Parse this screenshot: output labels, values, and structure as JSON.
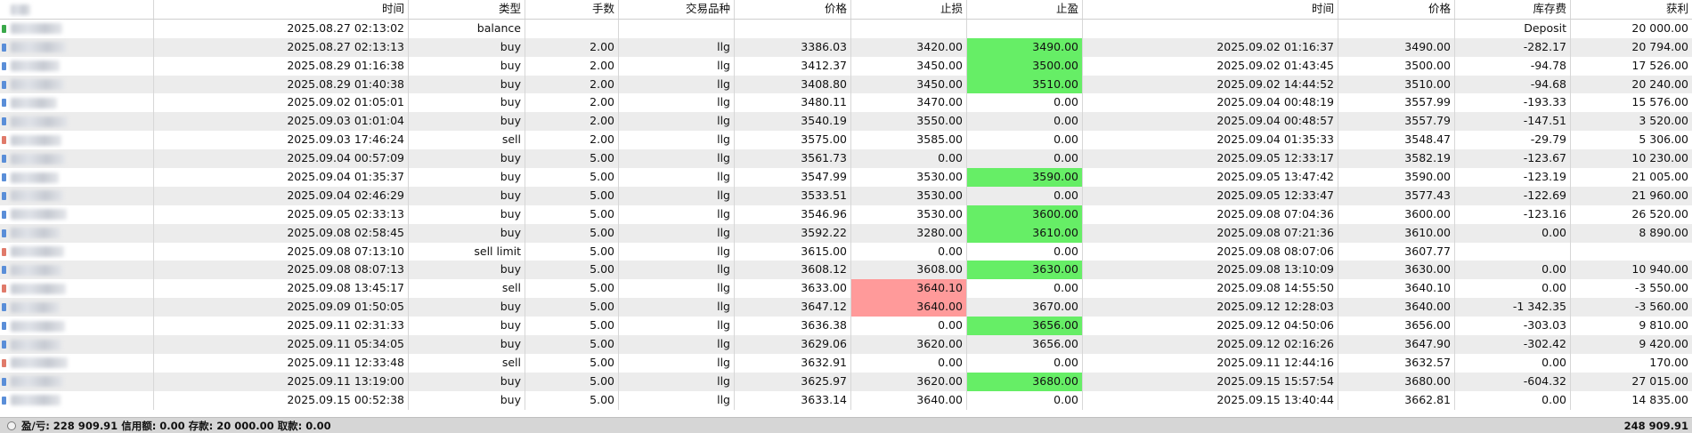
{
  "columns": {
    "id": "",
    "time": "时间",
    "type": "类型",
    "volume": "手数",
    "symbol": "交易品种",
    "price": "价格",
    "sl": "止损",
    "tp": "止盈",
    "close_time": "时间",
    "close_price": "价格",
    "swap": "库存费",
    "profit": "获利"
  },
  "rows": [
    {
      "time": "2025.08.27 02:13:02",
      "type": "balance",
      "volume": "",
      "symbol": "",
      "price": "",
      "sl": "",
      "tp": "",
      "close_time": "",
      "close_price": "",
      "swap": "Deposit",
      "profit": "20 000.00",
      "marker": "#3aa84a",
      "tp_hl": ""
    },
    {
      "time": "2025.08.27 02:13:13",
      "type": "buy",
      "volume": "2.00",
      "symbol": "llg",
      "price": "3386.03",
      "sl": "3420.00",
      "tp": "3490.00",
      "close_time": "2025.09.02 01:16:37",
      "close_price": "3490.00",
      "swap": "-282.17",
      "profit": "20 794.00",
      "marker": "#5a8ed8",
      "tp_hl": "green"
    },
    {
      "time": "2025.08.29 01:16:38",
      "type": "buy",
      "volume": "2.00",
      "symbol": "llg",
      "price": "3412.37",
      "sl": "3450.00",
      "tp": "3500.00",
      "close_time": "2025.09.02 01:43:45",
      "close_price": "3500.00",
      "swap": "-94.78",
      "profit": "17 526.00",
      "marker": "#5a8ed8",
      "tp_hl": "green"
    },
    {
      "time": "2025.08.29 01:40:38",
      "type": "buy",
      "volume": "2.00",
      "symbol": "llg",
      "price": "3408.80",
      "sl": "3450.00",
      "tp": "3510.00",
      "close_time": "2025.09.02 14:44:52",
      "close_price": "3510.00",
      "swap": "-94.68",
      "profit": "20 240.00",
      "marker": "#5a8ed8",
      "tp_hl": "green"
    },
    {
      "time": "2025.09.02 01:05:01",
      "type": "buy",
      "volume": "2.00",
      "symbol": "llg",
      "price": "3480.11",
      "sl": "3470.00",
      "tp": "0.00",
      "close_time": "2025.09.04 00:48:19",
      "close_price": "3557.99",
      "swap": "-193.33",
      "profit": "15 576.00",
      "marker": "#5a8ed8",
      "tp_hl": ""
    },
    {
      "time": "2025.09.03 01:01:04",
      "type": "buy",
      "volume": "2.00",
      "symbol": "llg",
      "price": "3540.19",
      "sl": "3550.00",
      "tp": "0.00",
      "close_time": "2025.09.04 00:48:57",
      "close_price": "3557.79",
      "swap": "-147.51",
      "profit": "3 520.00",
      "marker": "#5a8ed8",
      "tp_hl": ""
    },
    {
      "time": "2025.09.03 17:46:24",
      "type": "sell",
      "volume": "2.00",
      "symbol": "llg",
      "price": "3575.00",
      "sl": "3585.00",
      "tp": "0.00",
      "close_time": "2025.09.04 01:35:33",
      "close_price": "3548.47",
      "swap": "-29.79",
      "profit": "5 306.00",
      "marker": "#e07a6a",
      "tp_hl": ""
    },
    {
      "time": "2025.09.04 00:57:09",
      "type": "buy",
      "volume": "5.00",
      "symbol": "llg",
      "price": "3561.73",
      "sl": "0.00",
      "tp": "0.00",
      "close_time": "2025.09.05 12:33:17",
      "close_price": "3582.19",
      "swap": "-123.67",
      "profit": "10 230.00",
      "marker": "#5a8ed8",
      "tp_hl": ""
    },
    {
      "time": "2025.09.04 01:35:37",
      "type": "buy",
      "volume": "5.00",
      "symbol": "llg",
      "price": "3547.99",
      "sl": "3530.00",
      "tp": "3590.00",
      "close_time": "2025.09.05 13:47:42",
      "close_price": "3590.00",
      "swap": "-123.19",
      "profit": "21 005.00",
      "marker": "#5a8ed8",
      "tp_hl": "green"
    },
    {
      "time": "2025.09.04 02:46:29",
      "type": "buy",
      "volume": "5.00",
      "symbol": "llg",
      "price": "3533.51",
      "sl": "3530.00",
      "tp": "0.00",
      "close_time": "2025.09.05 12:33:47",
      "close_price": "3577.43",
      "swap": "-122.69",
      "profit": "21 960.00",
      "marker": "#5a8ed8",
      "tp_hl": ""
    },
    {
      "time": "2025.09.05 02:33:13",
      "type": "buy",
      "volume": "5.00",
      "symbol": "llg",
      "price": "3546.96",
      "sl": "3530.00",
      "tp": "3600.00",
      "close_time": "2025.09.08 07:04:36",
      "close_price": "3600.00",
      "swap": "-123.16",
      "profit": "26 520.00",
      "marker": "#5a8ed8",
      "tp_hl": "green"
    },
    {
      "time": "2025.09.08 02:58:45",
      "type": "buy",
      "volume": "5.00",
      "symbol": "llg",
      "price": "3592.22",
      "sl": "3280.00",
      "tp": "3610.00",
      "close_time": "2025.09.08 07:21:36",
      "close_price": "3610.00",
      "swap": "0.00",
      "profit": "8 890.00",
      "marker": "#5a8ed8",
      "tp_hl": "green"
    },
    {
      "time": "2025.09.08 07:13:10",
      "type": "sell limit",
      "volume": "5.00",
      "symbol": "llg",
      "price": "3615.00",
      "sl": "0.00",
      "tp": "0.00",
      "close_time": "2025.09.08 08:07:06",
      "close_price": "3607.77",
      "swap": "",
      "profit": "",
      "marker": "#e07a6a",
      "tp_hl": ""
    },
    {
      "time": "2025.09.08 08:07:13",
      "type": "buy",
      "volume": "5.00",
      "symbol": "llg",
      "price": "3608.12",
      "sl": "3608.00",
      "tp": "3630.00",
      "close_time": "2025.09.08 13:10:09",
      "close_price": "3630.00",
      "swap": "0.00",
      "profit": "10 940.00",
      "marker": "#5a8ed8",
      "tp_hl": "green"
    },
    {
      "time": "2025.09.08 13:45:17",
      "type": "sell",
      "volume": "5.00",
      "symbol": "llg",
      "price": "3633.00",
      "sl": "3640.10",
      "tp": "0.00",
      "close_time": "2025.09.08 14:55:50",
      "close_price": "3640.10",
      "swap": "0.00",
      "profit": "-3 550.00",
      "marker": "#e07a6a",
      "tp_hl": "",
      "sl_hl": "red"
    },
    {
      "time": "2025.09.09 01:50:05",
      "type": "buy",
      "volume": "5.00",
      "symbol": "llg",
      "price": "3647.12",
      "sl": "3640.00",
      "tp": "3670.00",
      "close_time": "2025.09.12 12:28:03",
      "close_price": "3640.00",
      "swap": "-1 342.35",
      "profit": "-3 560.00",
      "marker": "#5a8ed8",
      "tp_hl": "",
      "sl_hl": "red"
    },
    {
      "time": "2025.09.11 02:31:33",
      "type": "buy",
      "volume": "5.00",
      "symbol": "llg",
      "price": "3636.38",
      "sl": "0.00",
      "tp": "3656.00",
      "close_time": "2025.09.12 04:50:06",
      "close_price": "3656.00",
      "swap": "-303.03",
      "profit": "9 810.00",
      "marker": "#5a8ed8",
      "tp_hl": "green"
    },
    {
      "time": "2025.09.11 05:34:05",
      "type": "buy",
      "volume": "5.00",
      "symbol": "llg",
      "price": "3629.06",
      "sl": "3620.00",
      "tp": "3656.00",
      "close_time": "2025.09.12 02:16:26",
      "close_price": "3647.90",
      "swap": "-302.42",
      "profit": "9 420.00",
      "marker": "#5a8ed8",
      "tp_hl": ""
    },
    {
      "time": "2025.09.11 12:33:48",
      "type": "sell",
      "volume": "5.00",
      "symbol": "llg",
      "price": "3632.91",
      "sl": "0.00",
      "tp": "0.00",
      "close_time": "2025.09.11 12:44:16",
      "close_price": "3632.57",
      "swap": "0.00",
      "profit": "170.00",
      "marker": "#e07a6a",
      "tp_hl": ""
    },
    {
      "time": "2025.09.11 13:19:00",
      "type": "buy",
      "volume": "5.00",
      "symbol": "llg",
      "price": "3625.97",
      "sl": "3620.00",
      "tp": "3680.00",
      "close_time": "2025.09.15 15:57:54",
      "close_price": "3680.00",
      "swap": "-604.32",
      "profit": "27 015.00",
      "marker": "#5a8ed8",
      "tp_hl": "green"
    },
    {
      "time": "2025.09.15 00:52:38",
      "type": "buy",
      "volume": "5.00",
      "symbol": "llg",
      "price": "3633.14",
      "sl": "3640.00",
      "tp": "0.00",
      "close_time": "2025.09.15 13:40:44",
      "close_price": "3662.81",
      "swap": "0.00",
      "profit": "14 835.00",
      "marker": "#5a8ed8",
      "tp_hl": ""
    }
  ],
  "status": {
    "summary": "盈/亏: 228 909.91  信用额: 0.00  存款: 20 000.00  取款: 0.00",
    "total": "248 909.91"
  }
}
